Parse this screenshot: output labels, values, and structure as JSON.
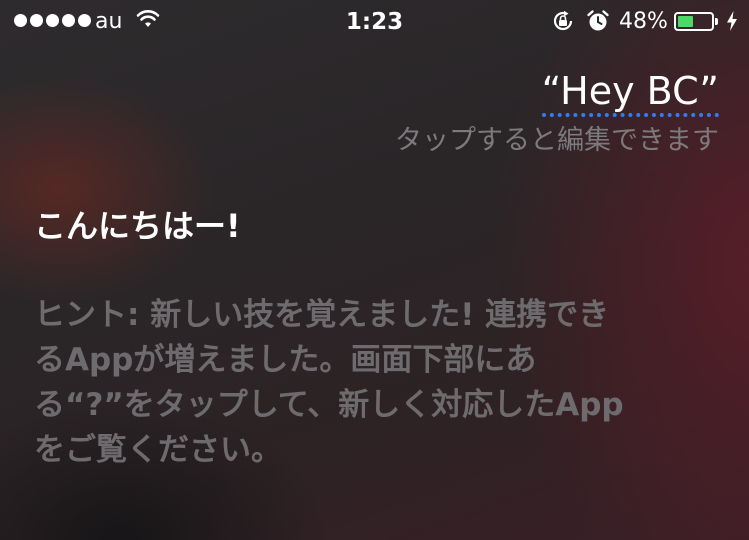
{
  "status_bar": {
    "carrier": "au",
    "time": "1:23",
    "battery_percent": "48%",
    "battery_level": 0.48,
    "battery_color": "#4cd964",
    "icons": [
      "signal-dots-icon",
      "wifi-icon",
      "rotation-lock-icon",
      "alarm-icon",
      "battery-icon",
      "charging-bolt-icon"
    ]
  },
  "siri": {
    "query": "“Hey BC”",
    "tap_to_edit": "タップすると編集できます",
    "greeting": "こんにちはー!",
    "hint": "ヒント: 新しい技を覚えました! 連携できるAppが増えました。画面下部にある“?”をタップして、新しく対応したAppをご覧ください。",
    "underline_color": "#2f7cf6"
  }
}
